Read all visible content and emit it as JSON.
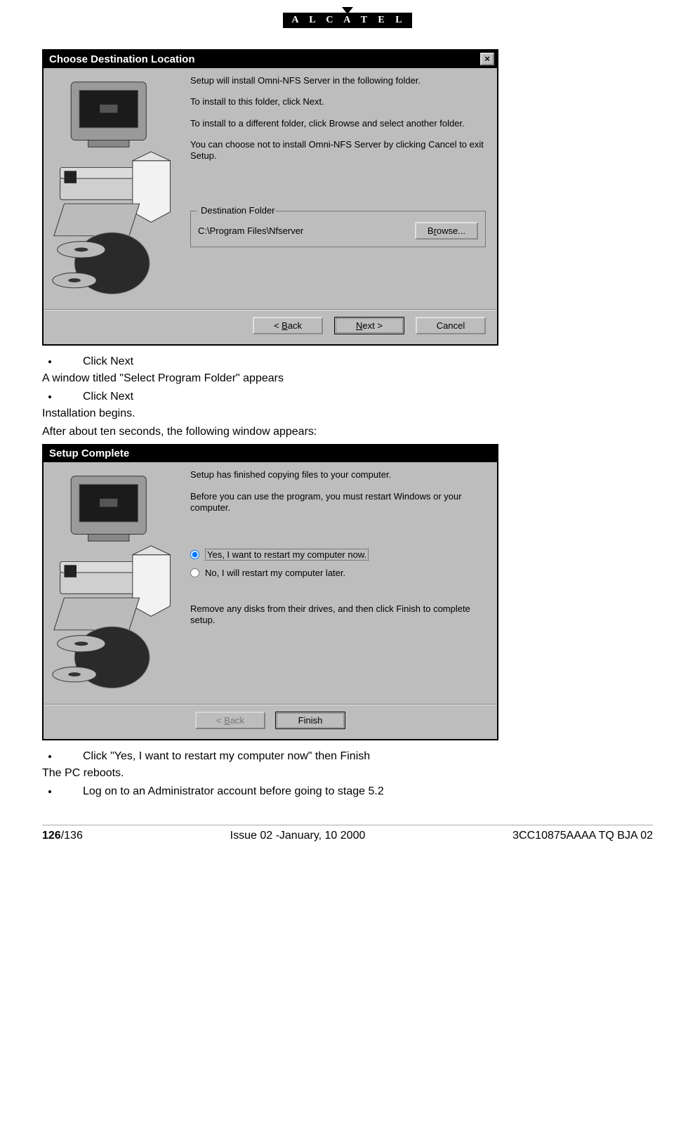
{
  "header": {
    "brand": "A L C A T E L"
  },
  "dialog1": {
    "title": "Choose Destination Location",
    "p1": "Setup will install Omni-NFS Server in the following folder.",
    "p2": "To install to this folder, click Next.",
    "p3": "To install to a different folder, click Browse and select another folder.",
    "p4": "You can choose not to install Omni-NFS Server by clicking Cancel to exit Setup.",
    "group_legend": "Destination Folder",
    "path": "C:\\Program Files\\Nfserver",
    "browse": "Browse...",
    "back_prefix": "< ",
    "back_u": "B",
    "back_rest": "ack",
    "next_u": "N",
    "next_rest": "ext >",
    "cancel": "Cancel"
  },
  "mid": {
    "b1": "Click Next",
    "l1": "A window titled \"Select Program Folder\" appears",
    "b2": "Click Next",
    "l2": "Installation begins.",
    "l3": "After about ten seconds, the following window appears:"
  },
  "dialog2": {
    "title": "Setup Complete",
    "p1": "Setup has finished copying files to your computer.",
    "p2": "Before you can use the program, you must restart Windows or your computer.",
    "r1": "Yes, I want to restart my computer now.",
    "r2": "No, I will restart my computer later.",
    "p3": "Remove any disks from their drives, and then click Finish to complete setup.",
    "back_prefix": "< ",
    "back_u": "B",
    "back_rest": "ack",
    "finish": "Finish"
  },
  "tail": {
    "b1": "Click \"Yes, I want to restart my computer now\" then Finish",
    "l1": "The PC reboots.",
    "b2": "Log on to an Administrator account before going to stage 5.2"
  },
  "footer": {
    "page_bold": "126",
    "page_total": "/136",
    "center": "Issue 02 -January, 10 2000",
    "right": "3CC10875AAAA TQ BJA 02"
  }
}
